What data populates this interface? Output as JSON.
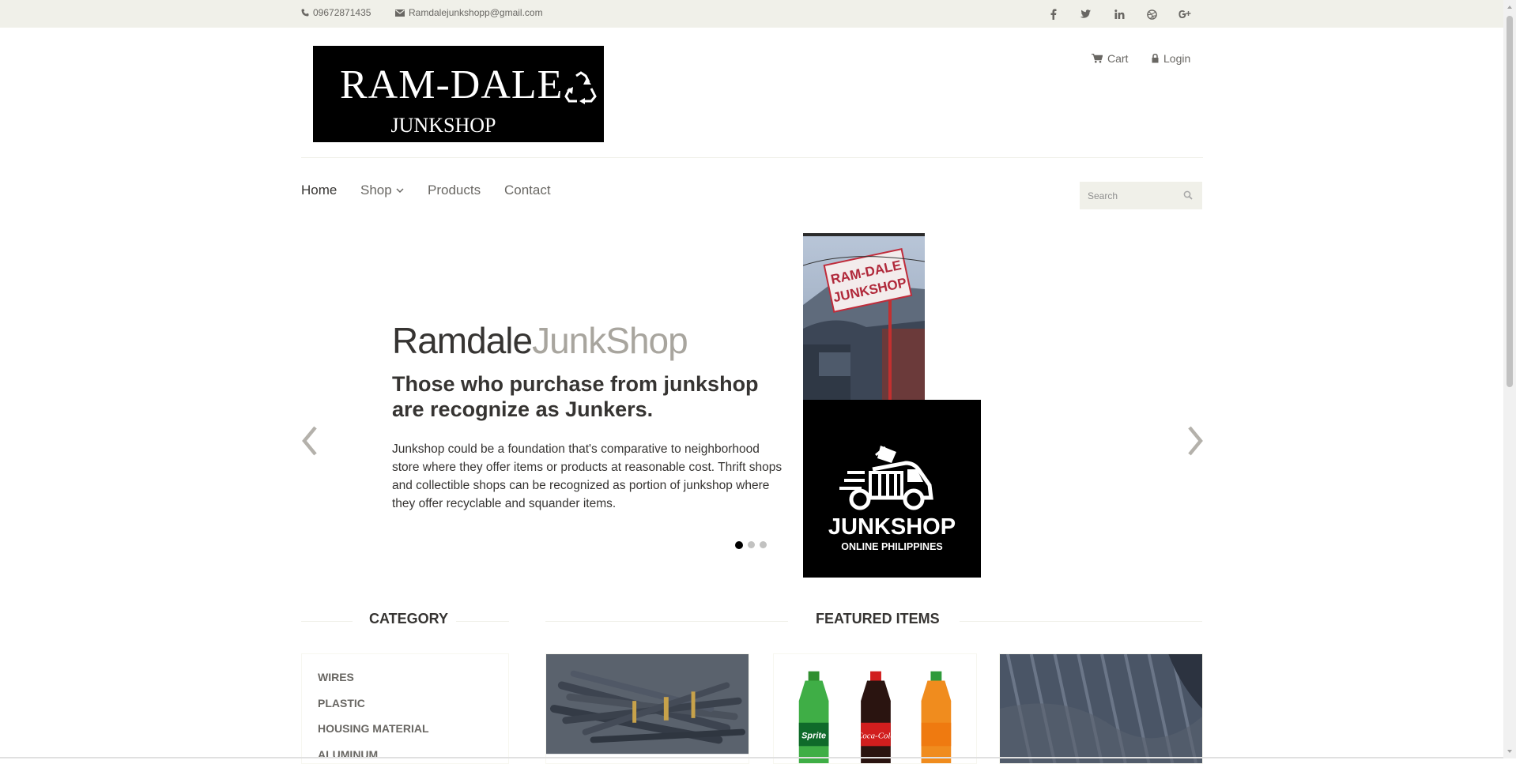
{
  "topbar": {
    "phone": "09672871435",
    "email": "Ramdalejunkshopp@gmail.com",
    "social_icons": [
      "facebook-icon",
      "twitter-icon",
      "linkedin-icon",
      "dribbble-icon",
      "google-plus-icon"
    ]
  },
  "header": {
    "logo_line1": "RAM-DALE",
    "logo_line2": "JUNKSHOP",
    "cart_label": "Cart",
    "login_label": "Login"
  },
  "nav": {
    "items": [
      "Home",
      "Shop",
      "Products",
      "Contact"
    ],
    "active": "Home",
    "search_placeholder": "Search"
  },
  "slider": {
    "title_part1": "Ramdale",
    "title_part2": "JunkShop",
    "heading": "Those who purchase from junkshop are recognize as Junkers.",
    "body": "Junkshop could be a foundation that's comparative to neighborhood store where they offer items or products at reasonable cost. Thrift shops and collectible shops can be recognized as portion of junkshop where they offer recyclable and squander items.",
    "active_slide": 1,
    "slide_count": 3,
    "sign_line1": "RAM-DALE",
    "sign_line2": "JUNKSHOP",
    "badge_line1": "JUNKSHOP",
    "badge_line2": "ONLINE PHILIPPINES"
  },
  "category": {
    "title": "Category",
    "items": [
      "Wires",
      "Plastic",
      "Housing Material",
      "Aluminum"
    ]
  },
  "featured": {
    "title": "Featured Items",
    "product_images": [
      "wires-image",
      "soda-bottles-image",
      "roofing-sheet-image"
    ]
  },
  "colors": {
    "topbar_bg": "#f0f0e9",
    "text": "#696763",
    "heading": "#363432",
    "title_accent": "#a8a59e"
  }
}
